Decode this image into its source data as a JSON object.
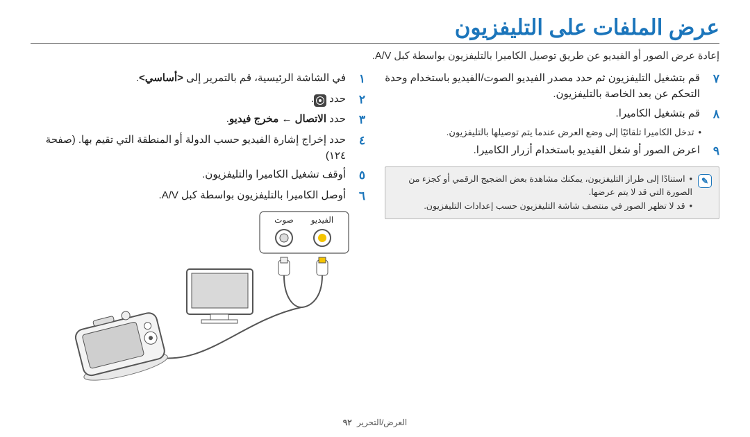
{
  "title": "عرض الملفات على التليفزيون",
  "intro": "إعادة عرض الصور أو الفيديو عن طريق توصيل الكاميرا بالتليفزيون بواسطة كبل A/V.",
  "stepsRight": {
    "n1": "١",
    "t1_pre": "في الشاشة الرئيسية، قم بالتمرير إلى ",
    "t1_bold": "<أساسي>",
    "t1_post": ".",
    "n2": "٢",
    "t2_pre": "حدد ",
    "t2_post": ".",
    "n3": "٣",
    "t3_pre": "حدد ",
    "t3_bold1": "الاتصال",
    "t3_arrow": " ← ",
    "t3_bold2": "مخرج فيديو",
    "t3_post": ".",
    "n4": "٤",
    "t4": "حدد إخراج إشارة الفيديو حسب الدولة أو المنطقة التي تقيم بها. (صفحة ١٢٤)",
    "n5": "٥",
    "t5": "أوقف تشغيل الكاميرا والتليفزيون.",
    "n6": "٦",
    "t6": "أوصل الكاميرا بالتليفزيون بواسطة كبل A/V."
  },
  "stepsLeft": {
    "n7": "٧",
    "t7": "قم بتشغيل التليفزيون ثم حدد مصدر الفيديو الصوت/الفيديو باستخدام وحدة التحكم عن بعد الخاصة بالتليفزيون.",
    "n8": "٨",
    "t8": "قم بتشغيل الكاميرا.",
    "b8": "تدخل الكاميرا تلقائيًا إلى وضع العرض عندما يتم توصيلها بالتليفزيون.",
    "n9": "٩",
    "t9": "اعرض الصور أو شغل الفيديو باستخدام أزرار الكاميرا."
  },
  "note": {
    "item1": "استنادًا إلى طراز التليفزيون، يمكنك مشاهدة بعض الضجيج الرقمي أو كجزء من الصورة التي قد لا يتم عرضها.",
    "item2": "قد لا تظهر الصور في منتصف شاشة التليفزيون حسب إعدادات التليفزيون."
  },
  "diagramLabels": {
    "video": "الفيديو",
    "audio": "صوت"
  },
  "footer": {
    "section": "العرض/التحرير",
    "page": "٩٢"
  }
}
